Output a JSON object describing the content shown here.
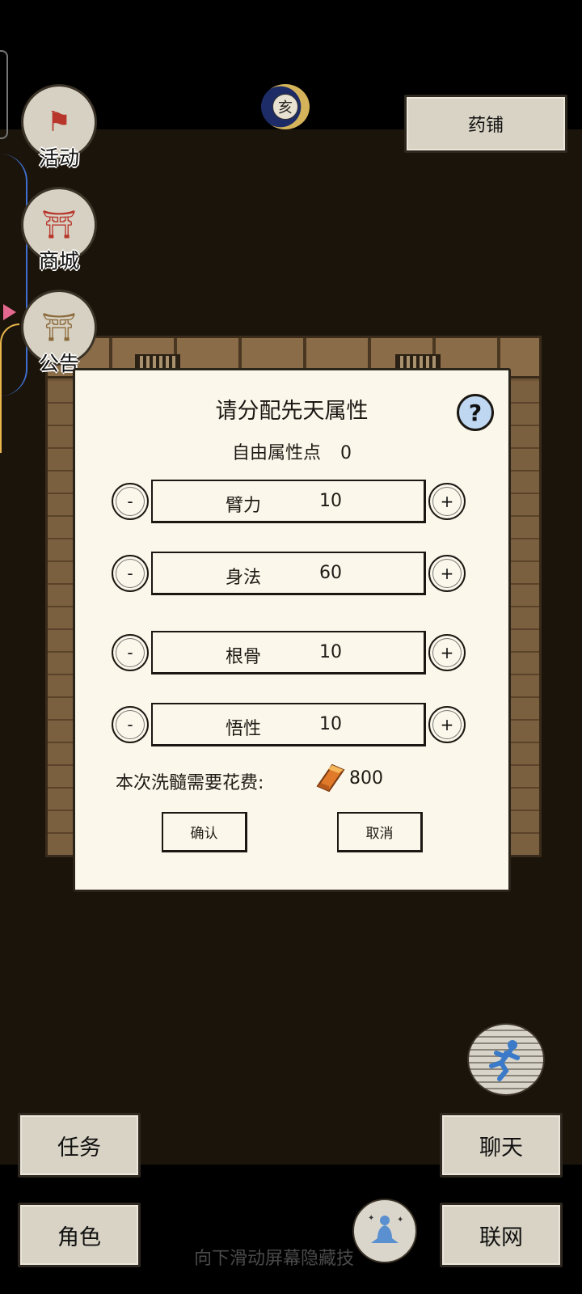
{
  "left_menu": [
    {
      "label": "活动",
      "glyph": "⚑"
    },
    {
      "label": "商城",
      "glyph": "⛩"
    },
    {
      "label": "公告",
      "glyph": "⛩"
    }
  ],
  "time_badge": {
    "glyph": "亥"
  },
  "top_right_button": "药铺",
  "dialog": {
    "title": "请分配先天属性",
    "help_glyph": "?",
    "free_points_label": "自由属性点",
    "free_points_value": "0",
    "minus_glyph": "-",
    "plus_glyph": "+",
    "attributes": [
      {
        "name": "臂力",
        "value": "10"
      },
      {
        "name": "身法",
        "value": "60"
      },
      {
        "name": "根骨",
        "value": "10"
      },
      {
        "name": "悟性",
        "value": "10"
      }
    ],
    "cost_label": "本次洗髓需要花费:",
    "cost_value": "800",
    "cost_icon": "gold-ingot-icon",
    "confirm_label": "确认",
    "cancel_label": "取消"
  },
  "bottom_buttons": {
    "task": "任务",
    "character": "角色",
    "chat": "聊天",
    "online": "联网"
  },
  "hint_text": "向下滑动屏幕隐藏技"
}
